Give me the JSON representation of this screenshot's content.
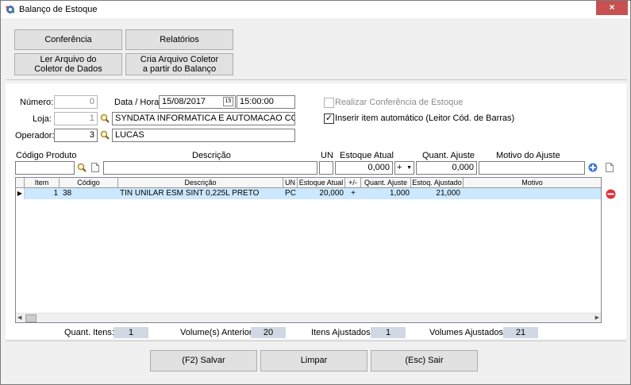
{
  "window": {
    "title": "Balanço de Estoque",
    "close_label": "×"
  },
  "toolbar": {
    "conferencia": "Conferência",
    "relatorios": "Relatórios",
    "ler_arquivo_l1": "Ler Arquivo do",
    "ler_arquivo_l2": "Coletor de Dados",
    "cria_arquivo_l1": "Cria Arquivo Coletor",
    "cria_arquivo_l2": "a partir do Balanço"
  },
  "form": {
    "numero_label": "Número:",
    "numero_value": "0",
    "data_hora_label": "Data / Hora:",
    "data_value": "15/08/2017",
    "calendar_label": "15",
    "hora_value": "15:00:00",
    "loja_label": "Loja:",
    "loja_value": "1",
    "loja_name": "SYNDATA INFORMATICA E AUTOMACAO COME",
    "operador_label": "Operador:",
    "operador_value": "3",
    "operador_name": "LUCAS",
    "realizar_conferencia": "Realizar Conferência de Estoque",
    "inserir_automatico": "Inserir item automático (Leitor Cód. de Barras)",
    "inserir_checked": "✓"
  },
  "entry": {
    "codigo_label": "Código Produto",
    "descricao_label": "Descrição",
    "un_label": "UN",
    "estoque_atual_label": "Estoque Atual",
    "quant_ajuste_label": "Quant. Ajuste",
    "motivo_label": "Motivo do Ajuste",
    "estoque_atual_value": "0,000",
    "sign_value": "+",
    "quant_ajuste_value": "0,000"
  },
  "grid": {
    "headers": [
      "Item",
      "Código",
      "Descrição",
      "UN",
      "Estoque Atual",
      "+/-",
      "Quant. Ajuste",
      "Estoq. Ajustado",
      "Motivo"
    ],
    "rows": [
      {
        "item": "1",
        "codigo": "38",
        "descricao": "TIN UNILAR ESM SINT 0,225L PRETO",
        "un": "PC",
        "estoque_atual": "20,000",
        "sinal": "+",
        "quant_ajuste": "1,000",
        "estoq_ajustado": "21,000",
        "motivo": ""
      }
    ]
  },
  "status": {
    "quant_itens_label": "Quant. Itens:",
    "quant_itens_value": "1",
    "volume_anterior_label": "Volume(s) Anterior:",
    "volume_anterior_value": "20",
    "itens_ajustados_label": "Itens Ajustados:",
    "itens_ajustados_value": "1",
    "volumes_ajustados_label": "Volumes Ajustados:",
    "volumes_ajustados_value": "21"
  },
  "footer": {
    "salvar": "(F2) Salvar",
    "limpar": "Limpar",
    "sair": "(Esc) Sair"
  },
  "colors": {
    "accent": "#3a78d4",
    "remove": "#e0303a",
    "selected_row": "#cce8ff"
  }
}
